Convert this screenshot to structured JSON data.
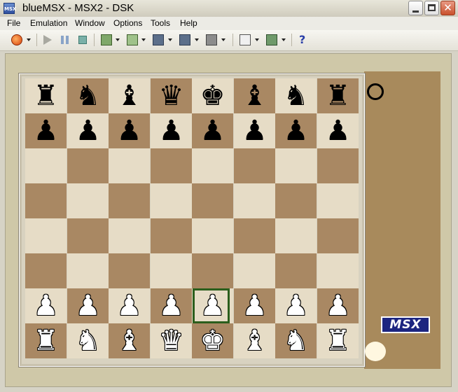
{
  "window": {
    "title": "blueMSX - MSX2 - DSK",
    "app_icon_text": "MSX"
  },
  "menu": [
    "File",
    "Emulation",
    "Window",
    "Options",
    "Tools",
    "Help"
  ],
  "toolbar": {
    "buttons": [
      "reset-icon",
      "play-icon",
      "pause-icon",
      "stop-icon",
      "cart1-icon",
      "cart2-icon",
      "disk-a-icon",
      "disk-b-icon",
      "cassette-icon",
      "window-size-icon",
      "properties-icon",
      "help-icon"
    ],
    "help_label": "?"
  },
  "emulator": {
    "logo": "MSX",
    "board": [
      [
        "♜",
        "♞",
        "♝",
        "♛",
        "♚",
        "♝",
        "♞",
        "♜"
      ],
      [
        "♟",
        "♟",
        "♟",
        "♟",
        "♟",
        "♟",
        "♟",
        "♟"
      ],
      [
        "",
        "",
        "",
        "",
        "",
        "",
        "",
        ""
      ],
      [
        "",
        "",
        "",
        "",
        "",
        "",
        "",
        ""
      ],
      [
        "",
        "",
        "",
        "",
        "",
        "",
        "",
        ""
      ],
      [
        "",
        "",
        "",
        "",
        "",
        "",
        "",
        ""
      ],
      [
        "♙",
        "♙",
        "♙",
        "♙",
        "♙",
        "♙",
        "♙",
        "♙"
      ],
      [
        "♖",
        "♘",
        "♗",
        "♕",
        "♔",
        "♗",
        "♘",
        "♖"
      ]
    ],
    "colors": {
      "light_square": "#e6dcc6",
      "dark_square": "#a98863",
      "side_panel": "#a88a5c",
      "cursor": "#2b5e1c",
      "logo_bg": "#1c2580"
    }
  }
}
